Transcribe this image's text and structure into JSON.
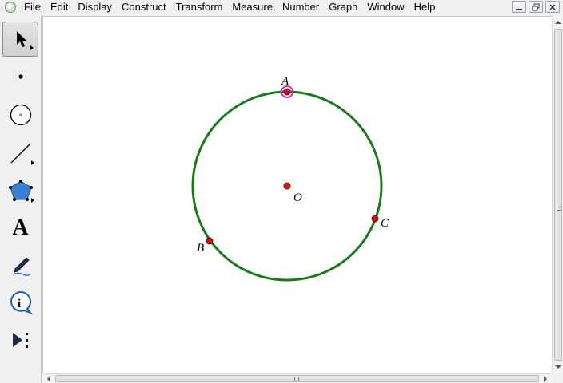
{
  "menu": [
    "File",
    "Edit",
    "Display",
    "Construct",
    "Transform",
    "Measure",
    "Number",
    "Graph",
    "Window",
    "Help"
  ],
  "toolbox": {
    "tools": [
      {
        "name": "arrow-select-tool",
        "icon": "arrow-icon"
      },
      {
        "name": "point-tool",
        "icon": "point-icon"
      },
      {
        "name": "compass-tool",
        "icon": "circle-icon"
      },
      {
        "name": "straightedge-tool",
        "icon": "line-icon"
      },
      {
        "name": "polygon-tool",
        "icon": "pentagon-icon"
      },
      {
        "name": "text-tool",
        "icon": "text-a-icon",
        "label": "A"
      },
      {
        "name": "marker-tool",
        "icon": "pen-icon"
      },
      {
        "name": "information-tool",
        "icon": "info-icon"
      },
      {
        "name": "custom-tool",
        "icon": "play-dots-icon"
      }
    ]
  },
  "canvas": {
    "circle_color": "#1a7a1a",
    "point_color": "#cc1111",
    "highlight_color": "#cc33cc",
    "points": [
      {
        "label": "A",
        "selected": true
      },
      {
        "label": "O",
        "selected": false
      },
      {
        "label": "B",
        "selected": false
      },
      {
        "label": "C",
        "selected": false
      }
    ]
  }
}
